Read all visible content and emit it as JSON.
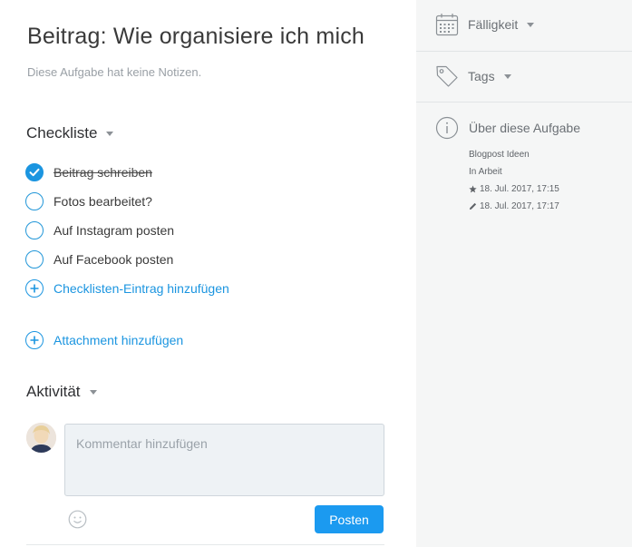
{
  "task": {
    "title": "Beitrag: Wie organisiere ich mich",
    "notes": "Diese Aufgabe hat keine Notizen."
  },
  "checklist": {
    "heading": "Checkliste",
    "items": [
      {
        "label": "Beitrag schreiben",
        "done": true
      },
      {
        "label": "Fotos bearbeitet?",
        "done": false
      },
      {
        "label": "Auf Instagram posten",
        "done": false
      },
      {
        "label": "Auf Facebook posten",
        "done": false
      }
    ],
    "add_label": "Checklisten-Eintrag hinzufügen"
  },
  "attachment": {
    "add_label": "Attachment hinzufügen"
  },
  "activity": {
    "heading": "Aktivität",
    "comment_placeholder": "Kommentar hinzufügen",
    "post_label": "Posten"
  },
  "sidebar": {
    "due_label": "Fälligkeit",
    "tags_label": "Tags",
    "about_title": "Über diese Aufgabe",
    "list_name": "Blogpost Ideen",
    "section_name": "In Arbeit",
    "created": "18. Jul. 2017, 17:15",
    "edited": "18. Jul. 2017, 17:17"
  },
  "colors": {
    "accent": "#1b95e0",
    "sidebar_bg": "#f5f6f6"
  },
  "icons": [
    "calendar-icon",
    "tag-icon",
    "info-icon",
    "star-icon",
    "pencil-icon",
    "plus-icon",
    "smiley-icon",
    "check-icon"
  ]
}
